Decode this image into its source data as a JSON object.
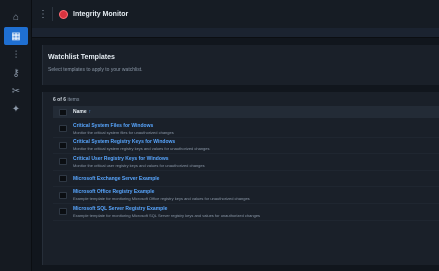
{
  "app": {
    "title": "Integrity Monitor"
  },
  "rail": {
    "items": [
      {
        "icon": "home-icon",
        "glyph": "⌂"
      },
      {
        "icon": "grid-icon",
        "glyph": "▦"
      },
      {
        "icon": "chart-icon",
        "glyph": "⫶"
      },
      {
        "icon": "key-icon",
        "glyph": "⚷"
      },
      {
        "icon": "tools-icon",
        "glyph": "✂"
      },
      {
        "icon": "pin-icon",
        "glyph": "✦"
      }
    ]
  },
  "header": {
    "title": "Watchlist Templates",
    "subtitle": "Select templates to apply to your watchlist."
  },
  "list": {
    "count_bold": "6 of 6",
    "count_rest": " items",
    "column_name": "Name",
    "sort_glyph": "↑",
    "rows": [
      {
        "name": "Critical System Files for Windows",
        "desc": "Monitor the critical system files for unauthorized changes"
      },
      {
        "name": "Critical System Registry Keys for Windows",
        "desc": "Monitor the critical system registry keys and values for unauthorized changes"
      },
      {
        "name": "Critical User Registry Keys for Windows",
        "desc": "Monitor the critical user registry keys and values for unauthorized changes"
      },
      {
        "name": "Microsoft Exchange Server Example",
        "desc": ""
      },
      {
        "name": "Microsoft Office Registry Example",
        "desc": "Example template for monitoring Microsoft Office registry keys and values for unauthorized changes"
      },
      {
        "name": "Microsoft SQL Server Registry Example",
        "desc": "Example template for monitoring Microsoft SQL Server registry keys and values for unauthorized changes"
      }
    ]
  }
}
